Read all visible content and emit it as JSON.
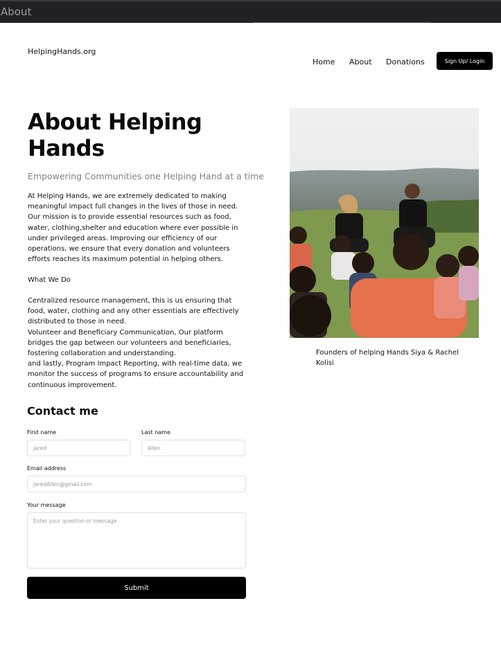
{
  "window": {
    "title": "About"
  },
  "header": {
    "logo": "HelpingHands.org",
    "nav": [
      {
        "label": "Home"
      },
      {
        "label": "About"
      },
      {
        "label": "Donations"
      }
    ],
    "cta_label": "Sign Up/ Login"
  },
  "about": {
    "title": "About Helping Hands",
    "subtitle": "Empowering Communities one Helping Hand at a time",
    "intro": "At Helping Hands, we are extremely dedicated to making meaningful impact full changes in the lives of those in need. Our mission is to provide essential resources such as food, water, clothing,shelter and education where ever possible in under privileged areas. Improving our efficiency of our operations, we ensure that every donation and volunteers efforts reaches its maximum potential in helping others.",
    "what_we_do_heading": "What We Do",
    "what_we_do": [
      "Centralized resource management, this is us ensuring that food, water, clothing and any other essentials are effectively distributed to those in need.",
      "Volunteer and Beneficiary Communication, Our platform bridges the gap between our volunteers and beneficiaries, fostering collaboration and understanding.",
      "and lastly, Program Impact Reporting, with real-time data, we monitor the success of programs to ensure accountability and continuous improvement."
    ]
  },
  "contact": {
    "title": "Contact me",
    "first_name": {
      "label": "First name",
      "placeholder": "Jared"
    },
    "last_name": {
      "label": "Last name",
      "placeholder": "Allen"
    },
    "email": {
      "label": "Email address",
      "placeholder": "JaredAllen@gmail.com"
    },
    "message": {
      "label": "Your message",
      "placeholder": "Enter your question or message"
    },
    "submit_label": "Submit"
  },
  "photo": {
    "caption": "Founders of helping Hands Siya & Rachel Kolisi"
  },
  "colors": {
    "topbar": "#202124",
    "primary_button": "#000000",
    "subtitle": "#828282",
    "input_border": "#e0e0e0"
  }
}
